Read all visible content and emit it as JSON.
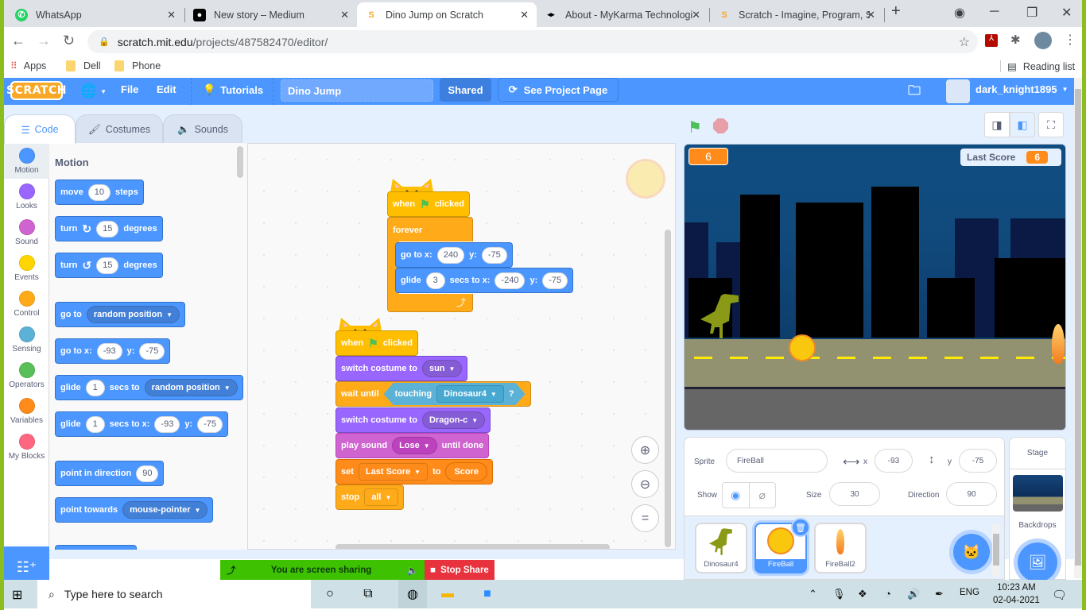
{
  "browser": {
    "tabs": [
      {
        "label": "WhatsApp",
        "icon": "whatsapp-icon",
        "active": false
      },
      {
        "label": "New story – Medium",
        "icon": "medium-icon",
        "active": false
      },
      {
        "label": "Dino Jump on Scratch",
        "icon": "scratch-icon",
        "active": true
      },
      {
        "label": "About - MyKarma Technologi",
        "icon": "mykarma-icon",
        "active": false
      },
      {
        "label": "Scratch - Imagine, Program, S",
        "icon": "scratch-icon",
        "active": false
      }
    ],
    "new_tab": "+",
    "url_host": "scratch.mit.edu",
    "url_path": "/projects/487582470/editor/",
    "bookmarks": [
      {
        "label": "Apps",
        "icon": "apps-grid-icon"
      },
      {
        "label": "Dell",
        "icon": "folder-icon"
      },
      {
        "label": "Phone",
        "icon": "folder-icon"
      }
    ],
    "reading_list": "Reading list"
  },
  "scratch_menu": {
    "logo": "SCRATCH",
    "file": "File",
    "edit": "Edit",
    "tutorials": "Tutorials",
    "project_title": "Dino Jump",
    "shared": "Shared",
    "see_project_page": "See Project Page",
    "username": "dark_knight1895"
  },
  "editor_tabs": [
    {
      "label": "Code",
      "active": true
    },
    {
      "label": "Costumes",
      "active": false
    },
    {
      "label": "Sounds",
      "active": false
    }
  ],
  "categories": [
    {
      "label": "Motion",
      "color": "#4c97ff",
      "selected": true
    },
    {
      "label": "Looks",
      "color": "#9966ff"
    },
    {
      "label": "Sound",
      "color": "#cf63cf"
    },
    {
      "label": "Events",
      "color": "#ffd500"
    },
    {
      "label": "Control",
      "color": "#ffab19"
    },
    {
      "label": "Sensing",
      "color": "#5cb1d6"
    },
    {
      "label": "Operators",
      "color": "#59c059"
    },
    {
      "label": "Variables",
      "color": "#ff8c1a"
    },
    {
      "label": "My Blocks",
      "color": "#ff6680"
    }
  ],
  "palette": {
    "title": "Motion",
    "move": {
      "pre": "move",
      "value": "10",
      "post": "steps"
    },
    "turn_right": {
      "pre": "turn",
      "value": "15",
      "post": "degrees"
    },
    "turn_left": {
      "pre": "turn",
      "value": "15",
      "post": "degrees"
    },
    "goto": {
      "pre": "go to",
      "option": "random position"
    },
    "goto_xy": {
      "pre": "go to x:",
      "x": "-93",
      "ylabel": "y:",
      "y": "-75"
    },
    "glide_to": {
      "pre": "glide",
      "secs": "1",
      "mid": "secs to",
      "option": "random position"
    },
    "glide_xy": {
      "pre": "glide",
      "secs": "1",
      "mid": "secs to x:",
      "x": "-93",
      "ylabel": "y:",
      "y": "-75"
    },
    "point_dir": {
      "pre": "point in direction",
      "value": "90"
    },
    "point_towards": {
      "pre": "point towards",
      "option": "mouse-pointer"
    }
  },
  "scripts": {
    "script1": {
      "hat": {
        "pre": "when",
        "post": "clicked"
      },
      "forever": "forever",
      "goto": {
        "pre": "go to x:",
        "x": "240",
        "ylabel": "y:",
        "y": "-75"
      },
      "glide": {
        "pre": "glide",
        "secs": "3",
        "mid": "secs to x:",
        "x": "-240",
        "ylabel": "y:",
        "y": "-75"
      }
    },
    "script2": {
      "hat": {
        "pre": "when",
        "post": "clicked"
      },
      "costume1": {
        "pre": "switch costume to",
        "option": "sun"
      },
      "wait": {
        "pre": "wait until",
        "sensing": "touching",
        "option": "Dinosaur4",
        "q": "?"
      },
      "costume2": {
        "pre": "switch costume to",
        "option": "Dragon-c"
      },
      "sound": {
        "pre": "play sound",
        "option": "Lose",
        "post": "until done"
      },
      "set": {
        "pre": "set",
        "var": "Last Score",
        "mid": "to",
        "value": "Score"
      },
      "stop": {
        "pre": "stop",
        "option": "all"
      }
    }
  },
  "stage": {
    "score_monitor": "6",
    "last_score_label": "Last Score",
    "last_score_value": "6"
  },
  "sprite_info": {
    "sprite_label": "Sprite",
    "sprite_name": "FireBall",
    "x_label": "x",
    "x": "-93",
    "y_label": "y",
    "y": "-75",
    "show_label": "Show",
    "size_label": "Size",
    "size": "30",
    "direction_label": "Direction",
    "direction": "90"
  },
  "sprites": [
    {
      "name": "Dinosaur4",
      "selected": false
    },
    {
      "name": "FireBall",
      "selected": true
    },
    {
      "name": "FireBall2",
      "selected": false
    }
  ],
  "stage_panel": {
    "title": "Stage",
    "backdrops": "Backdrops"
  },
  "screen_share": {
    "status": "You are screen sharing",
    "stop": "Stop Share"
  },
  "taskbar": {
    "search_placeholder": "Type here to search",
    "lang": "ENG",
    "time": "10:23 AM",
    "date": "02-04-2021"
  }
}
